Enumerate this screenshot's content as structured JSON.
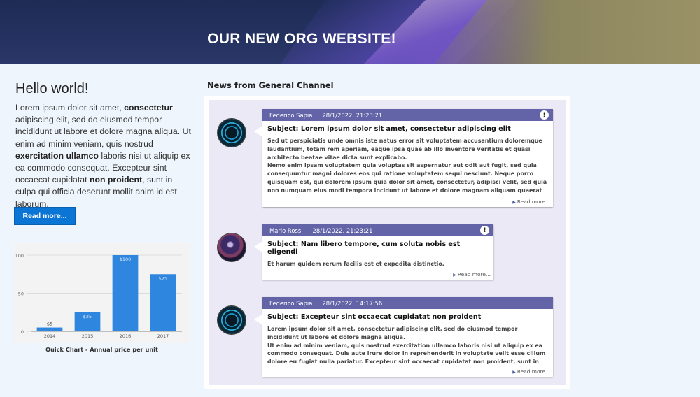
{
  "header": {
    "title": "OUR NEW ORG WEBSITE!"
  },
  "intro": {
    "heading": "Hello world!",
    "parts": {
      "p1": "Lorem ipsum dolor sit amet, ",
      "b1": "consectetur",
      "p2": " adipiscing elit, sed do eiusmod tempor incididunt ut labore et dolore magna aliqua. Ut enim ad minim veniam, quis nostrud ",
      "b2": "exercitation ullamco",
      "p3": " laboris nisi ut aliquip ex ea commodo consequat. Excepteur sint occaecat cupidatat ",
      "b3": "non proident",
      "p4": ", sunt in culpa qui officia deserunt mollit anim id est laborum."
    },
    "button": "Read more..."
  },
  "chart_caption": "Quick Chart - Annual price per unit",
  "chart_data": {
    "type": "bar",
    "categories": [
      "2014",
      "2015",
      "2016",
      "2017"
    ],
    "values": [
      5,
      25,
      100,
      75
    ],
    "data_labels": [
      "$5",
      "$25",
      "$100",
      "$75"
    ],
    "yticks": [
      "0",
      "50",
      "100"
    ],
    "ylim": [
      0,
      100
    ],
    "color": "#2e86de"
  },
  "news": {
    "heading": "News from General Channel",
    "more_label": "Read more...",
    "items": [
      {
        "author": "Federico Sapia",
        "date": "28/1/2022, 21:23:21",
        "important": true,
        "subject": "Subject: Lorem ipsum dolor sit amet, consectetur adipiscing elit",
        "body1": "Sed ut perspiciatis unde omnis iste natus error sit voluptatem accusantium doloremque laudantium, totam rem aperiam, eaque ipsa quae ab illo inventore veritatis et quasi architecto beatae vitae dicta sunt explicabo.",
        "body2": "Nemo enim ipsam voluptatem quia voluptas sit aspernatur aut odit aut fugit, sed quia consequuntur magni dolores eos qui ratione voluptatem sequi nesciunt. Neque porro quisquam est, qui dolorem ipsum quia dolor sit amet, consectetur, adipisci velit, sed quia non numquam eius modi tempora incidunt ut labore et dolore magnam aliquam quaerat"
      },
      {
        "author": "Mario Rossi",
        "date": "28/1/2022, 21:23:21",
        "important": true,
        "subject": "Subject: Nam libero tempore, cum soluta nobis est eligendi",
        "body1": "Et harum quidem rerum facilis est et expedita distinctio.",
        "body2": ""
      },
      {
        "author": "Federico Sapia",
        "date": "28/1/2022, 14:17:56",
        "important": false,
        "subject": "Subject: Excepteur sint occaecat cupidatat non proident",
        "body1": "Lorem ipsum dolor sit amet, consectetur adipiscing elit, sed do eiusmod tempor incididunt ut labore et dolore magna aliqua.",
        "body2": "Ut enim ad minim veniam, quis nostrud exercitation ullamco laboris nisi ut aliquip ex ea commodo consequat. Duis aute irure dolor in reprehenderit in voluptate velit esse cillum dolore eu fugiat nulla pariatur. Excepteur sint occaecat cupidatat non proident, sunt in culpa"
      }
    ],
    "alert_glyph": "!",
    "more_icon": "triangle-right-icon"
  }
}
